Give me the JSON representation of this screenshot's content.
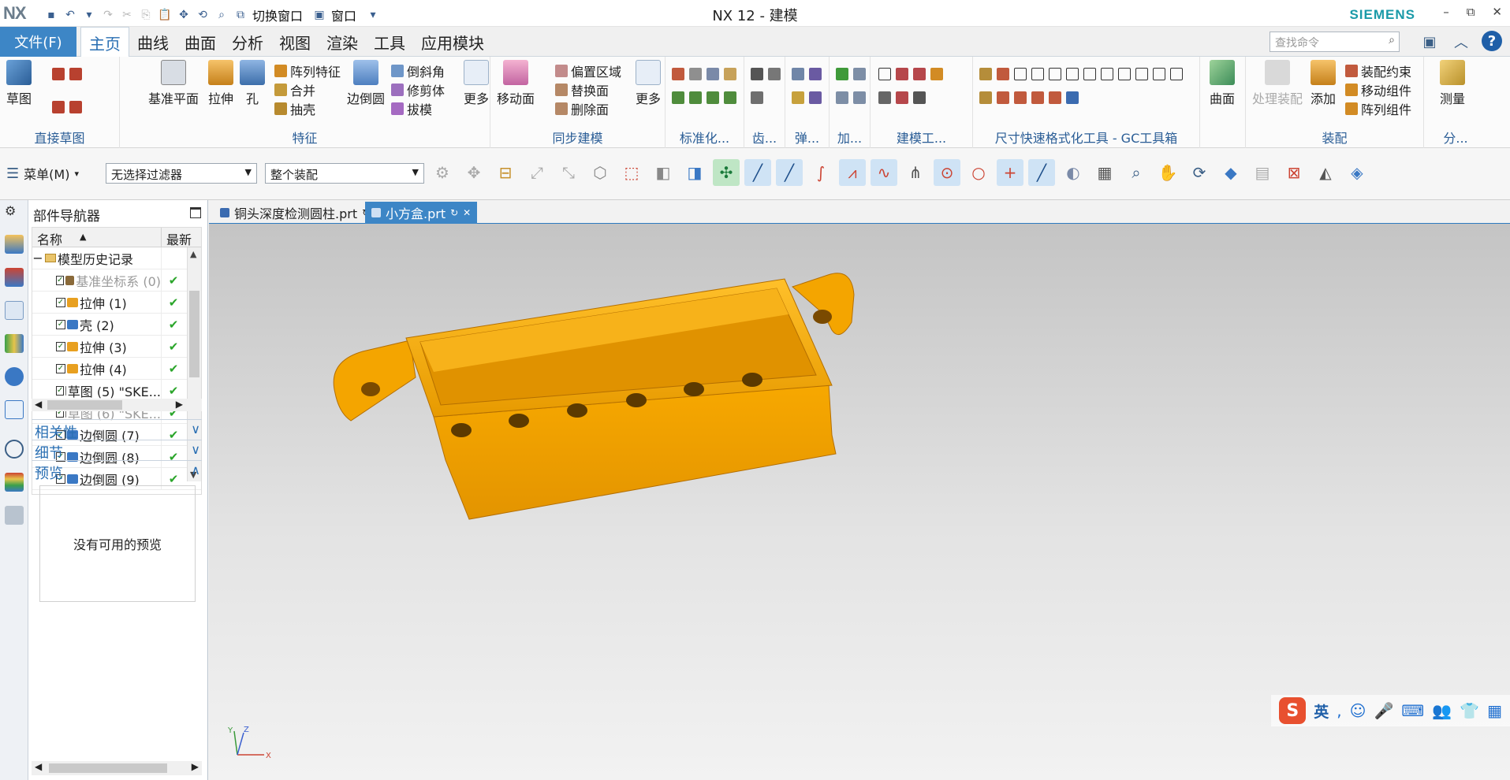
{
  "titlebar": {
    "logo": "NX",
    "switch_window": "切换窗口",
    "window_menu": "窗口",
    "app_title": "NX 12 - 建模",
    "brand": "SIEMENS",
    "minimize": "–",
    "restore": "⧉",
    "close": "✕"
  },
  "menubar": {
    "file": "文件(F)",
    "tabs": [
      "主页",
      "曲线",
      "曲面",
      "分析",
      "视图",
      "渲染",
      "工具",
      "应用模块"
    ],
    "search_placeholder": "查找命令"
  },
  "ribbon": {
    "direct_sketch": {
      "label": "直接草图",
      "sketch": "草图"
    },
    "features": {
      "label": "特征",
      "datum_plane": "基准平面",
      "extrude": "拉伸",
      "hole": "孔",
      "pattern_feature": "阵列特征",
      "unite": "合并",
      "shell": "抽壳",
      "edge_blend": "边倒圆",
      "chamfer": "倒斜角",
      "trim_body": "修剪体",
      "draft": "拔模",
      "more": "更多"
    },
    "sync": {
      "label": "同步建模",
      "move_face": "移动面",
      "offset_region": "偏置区域",
      "replace_face": "替换面",
      "delete_face": "删除面",
      "more": "更多"
    },
    "standard": {
      "label": "标准化..."
    },
    "gear": {
      "label": "齿..."
    },
    "spring": {
      "label": "弹..."
    },
    "add": {
      "label": "加..."
    },
    "modeling_tools": {
      "label": "建模工..."
    },
    "gc_toolbox": {
      "label": "尺寸快速格式化工具 - GC工具箱"
    },
    "surface": {
      "label": "曲面"
    },
    "assembly": {
      "label": "装配",
      "process_assembly": "处理装配",
      "add": "添加",
      "constraint": "装配约束",
      "move_component": "移动组件",
      "pattern_component": "阵列组件"
    },
    "analysis": {
      "label": "分...",
      "measure": "测量"
    }
  },
  "selbar": {
    "menu": "菜单(M)",
    "filter": "无选择过滤器",
    "scope": "整个装配"
  },
  "navigator": {
    "title": "部件导航器",
    "col_name": "名称",
    "col_latest": "最新",
    "root": "模型历史记录",
    "rows": [
      {
        "label": "基准坐标系 (0)",
        "greyed": true,
        "color": "#8a6a3a"
      },
      {
        "label": "拉伸 (1)",
        "greyed": false,
        "color": "#e8a020"
      },
      {
        "label": "壳 (2)",
        "greyed": false,
        "color": "#3a78c4"
      },
      {
        "label": "拉伸 (3)",
        "greyed": false,
        "color": "#e8a020"
      },
      {
        "label": "拉伸 (4)",
        "greyed": false,
        "color": "#e8a020"
      },
      {
        "label": "草图 (5) \"SKE...",
        "greyed": false,
        "color": "#6b6b6b"
      },
      {
        "label": "草图 (6) \"SKE...",
        "greyed": true,
        "color": "#6b6b6b"
      },
      {
        "label": "边倒圆 (7)",
        "greyed": false,
        "color": "#3a78c4"
      },
      {
        "label": "边倒圆 (8)",
        "greyed": false,
        "color": "#3a78c4"
      },
      {
        "label": "边倒圆 (9)",
        "greyed": false,
        "color": "#3a78c4"
      }
    ],
    "dependencies": "相关性",
    "details": "细节",
    "preview": "预览",
    "no_preview": "没有可用的预览"
  },
  "doctabs": [
    {
      "label": "铜头深度检测圆柱.prt",
      "active": false
    },
    {
      "label": "小方盒.prt",
      "active": true
    }
  ],
  "viewport": {
    "part_color": "#f2a40c",
    "triad_x": "X",
    "triad_y": "Y",
    "triad_z": "Z"
  },
  "ime": {
    "logo": "S",
    "lang": "英"
  }
}
